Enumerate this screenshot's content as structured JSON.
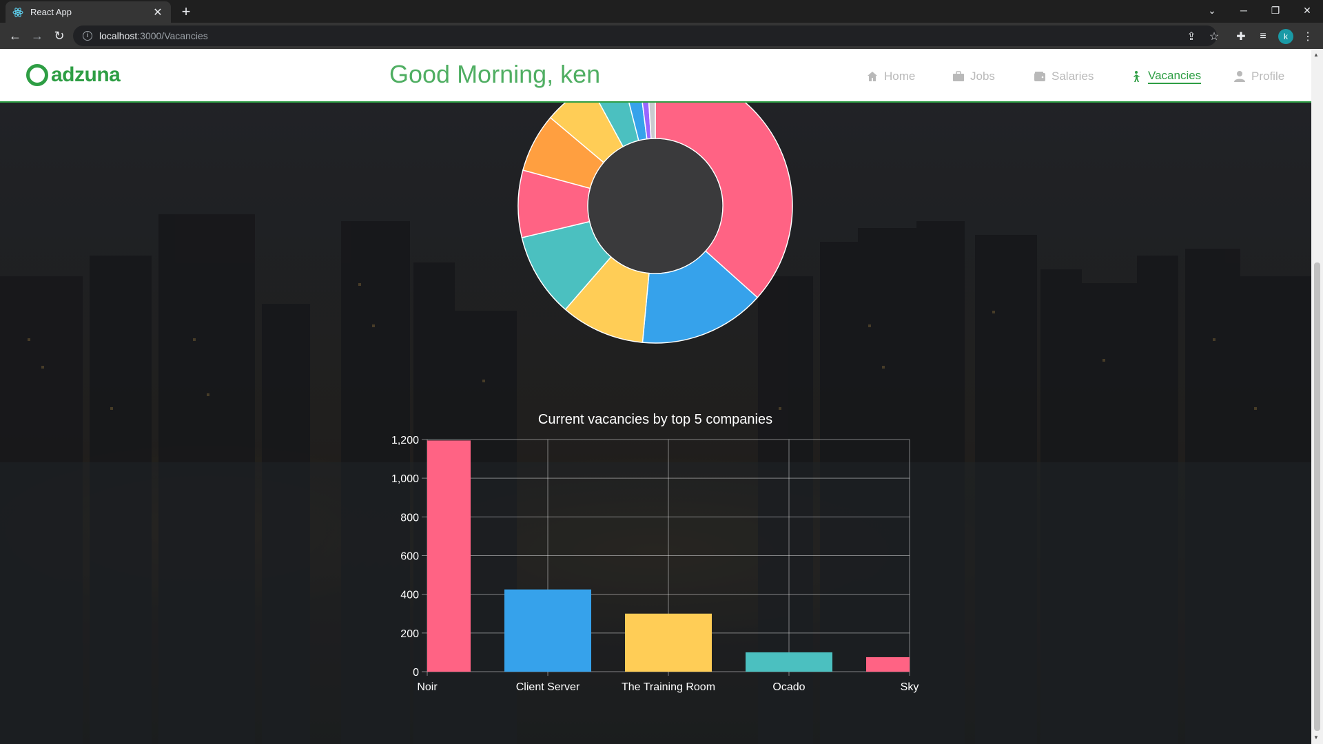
{
  "browser": {
    "tab_title": "React App",
    "url_host": "localhost",
    "url_path": ":3000/Vacancies",
    "profile_initial": "k"
  },
  "app": {
    "greeting": "Good Morning, ken",
    "logo_text": "adzuna",
    "brand_color": "#2e9e44",
    "nav": [
      {
        "label": "Home",
        "icon": "home-icon",
        "active": false
      },
      {
        "label": "Jobs",
        "icon": "briefcase-icon",
        "active": false
      },
      {
        "label": "Salaries",
        "icon": "wallet-icon",
        "active": false
      },
      {
        "label": "Vacancies",
        "icon": "person-icon",
        "active": true
      },
      {
        "label": "Profile",
        "icon": "user-icon",
        "active": false
      }
    ]
  },
  "chart_data": [
    {
      "type": "pie",
      "variant": "doughnut",
      "note_visible": "top portion cut off by viewport",
      "slices": [
        {
          "value": 37,
          "color": "#ff6384"
        },
        {
          "value": 15,
          "color": "#36a2eb"
        },
        {
          "value": 10,
          "color": "#ffcd56"
        },
        {
          "value": 10,
          "color": "#4bc0c0"
        },
        {
          "value": 8,
          "color": "#ff6384"
        },
        {
          "value": 7,
          "color": "#ff9f40"
        },
        {
          "value": 6,
          "color": "#ffcd56"
        },
        {
          "value": 4,
          "color": "#4bc0c0"
        },
        {
          "value": 2,
          "color": "#36a2eb"
        },
        {
          "value": 1,
          "color": "#9966ff"
        },
        {
          "value": 1,
          "color": "#c9cbcf"
        }
      ]
    },
    {
      "type": "bar",
      "title": "Current vacancies by top 5 companies",
      "categories": [
        "Noir",
        "Client Server",
        "The Training Room",
        "Ocado",
        "Sky"
      ],
      "values": [
        1195,
        425,
        300,
        100,
        75
      ],
      "colors": [
        "#ff6384",
        "#36a2eb",
        "#ffcd56",
        "#4bc0c0",
        "#ff6384"
      ],
      "ylim": [
        0,
        1200
      ],
      "yticks": [
        "0",
        "200",
        "400",
        "600",
        "800",
        "1,000",
        "1,200"
      ],
      "grid": true
    }
  ]
}
